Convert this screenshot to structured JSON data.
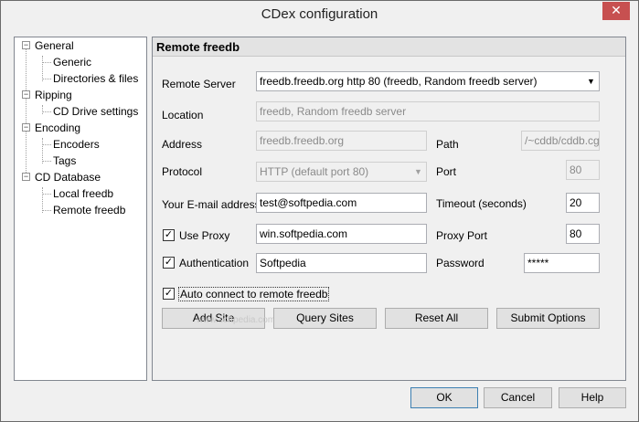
{
  "window": {
    "title": "CDex configuration",
    "close_glyph": "✕"
  },
  "tree": {
    "general": "General",
    "generic": "Generic",
    "directories": "Directories & files",
    "ripping": "Ripping",
    "cd_drive": "CD Drive settings",
    "encoding": "Encoding",
    "encoders": "Encoders",
    "tags": "Tags",
    "cd_database": "CD Database",
    "local_freedb": "Local freedb",
    "remote_freedb": "Remote freedb",
    "expander_glyph": "−"
  },
  "panel": {
    "title": "Remote freedb",
    "remote_server_label": "Remote Server",
    "remote_server_value": "freedb.freedb.org http  80  (freedb, Random freedb server)",
    "location_label": "Location",
    "location_value": "freedb, Random freedb server",
    "address_label": "Address",
    "address_value": "freedb.freedb.org",
    "path_label": "Path",
    "path_value": "/~cddb/cddb.cgi",
    "protocol_label": "Protocol",
    "protocol_value": "HTTP (default port 80)",
    "port_label": "Port",
    "port_value": "80",
    "email_label": "Your E-mail address",
    "email_value": "test@softpedia.com",
    "timeout_label": "Timeout (seconds)",
    "timeout_value": "20",
    "use_proxy_label": "Use Proxy",
    "proxy_value": "win.softpedia.com",
    "proxy_port_label": "Proxy Port",
    "proxy_port_value": "80",
    "authentication_label": "Authentication",
    "auth_value": "Softpedia",
    "password_label": "Password",
    "password_value": "*****",
    "auto_connect_label": "Auto connect to remote freedb",
    "check_glyph": "✓",
    "arrow_glyph": "▼",
    "buttons": {
      "add_site": "Add Site",
      "query_sites": "Query Sites",
      "reset_all": "Reset All",
      "submit_options": "Submit Options"
    },
    "watermark": "www.softpedia.com"
  },
  "footer": {
    "ok": "OK",
    "cancel": "Cancel",
    "help": "Help"
  }
}
